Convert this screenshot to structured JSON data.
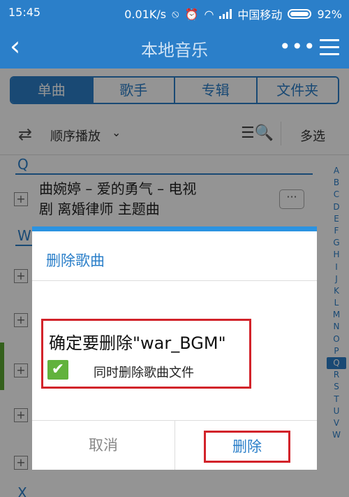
{
  "status_bar": {
    "time": "15:45",
    "network_speed": "0.01K/s",
    "carrier": "中国移动",
    "battery": "92%"
  },
  "header": {
    "back_icon": "back-arrow-icon",
    "title": "本地音乐",
    "more_icon": "more-dots-icon",
    "menu_icon": "menu-icon"
  },
  "tabs": [
    {
      "label": "单曲",
      "active": true
    },
    {
      "label": "歌手",
      "active": false
    },
    {
      "label": "专辑",
      "active": false
    },
    {
      "label": "文件夹",
      "active": false
    }
  ],
  "toolbar": {
    "play_order_label": "顺序播放",
    "multi_select_label": "多选"
  },
  "list": {
    "sections": [
      {
        "letter": "Q"
      },
      {
        "letter": "W"
      },
      {
        "letter": "X"
      }
    ],
    "song_q_line1": "曲婉婷 – 爱的勇气 – 电视",
    "song_q_line2": "剧 离婚律师 主题曲",
    "add_symbol": "+",
    "more_symbol": "···"
  },
  "index_bar": {
    "letters": [
      "A",
      "B",
      "C",
      "D",
      "E",
      "F",
      "G",
      "H",
      "I",
      "J",
      "K",
      "L",
      "M",
      "N",
      "O",
      "P",
      "Q",
      "R",
      "S",
      "T",
      "U",
      "V",
      "W"
    ],
    "active": "Q"
  },
  "dialog": {
    "title": "删除歌曲",
    "confirm_text": "确定要删除\"war_BGM\"",
    "checkbox_label": "同时删除歌曲文件",
    "checkbox_checked": true,
    "cancel_label": "取消",
    "delete_label": "删除"
  },
  "colors": {
    "primary": "#2b7fc9",
    "highlight_red": "#d2232a",
    "check_green": "#62b23c"
  }
}
